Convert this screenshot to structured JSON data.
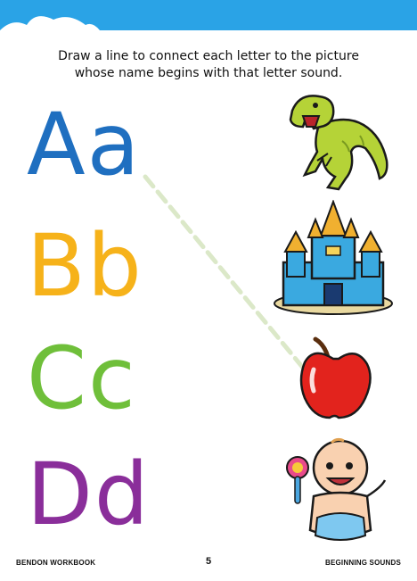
{
  "instructions": {
    "line1": "Draw a line to connect each letter to the picture",
    "line2": "whose name begins with that letter sound."
  },
  "letters": [
    {
      "text": "Aa",
      "color": "#1f6fc0"
    },
    {
      "text": "Bb",
      "color": "#f6b21a"
    },
    {
      "text": "Cc",
      "color": "#6fbf3a"
    },
    {
      "text": "Dd",
      "color": "#8a2e9a"
    }
  ],
  "pictures": [
    {
      "icon": "dinosaur-icon"
    },
    {
      "icon": "castle-icon"
    },
    {
      "icon": "apple-icon"
    },
    {
      "icon": "baby-icon"
    }
  ],
  "colors": {
    "top_band": "#2aa3e6",
    "connector_line": "#dbe8c8"
  },
  "footer": {
    "left": "BENDON WORKBOOK",
    "page_number": "5",
    "right": "BEGINNING SOUNDS"
  }
}
